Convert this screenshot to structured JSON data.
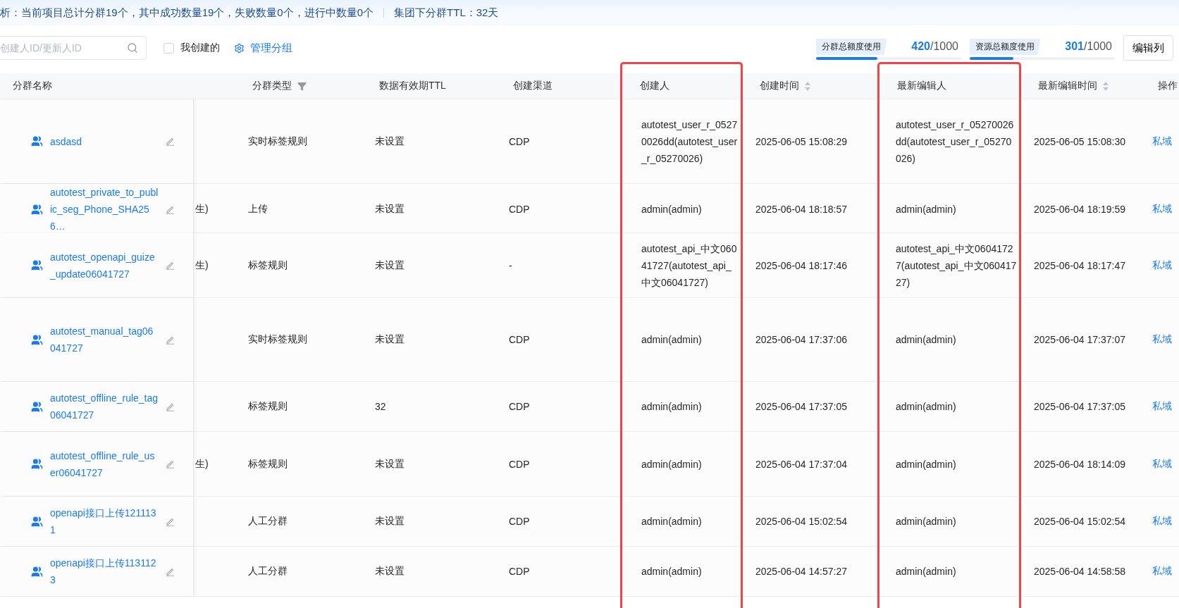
{
  "summary": {
    "text": "析：当前项目总计分群19个，其中成功数量19个，失败数量0个，进行中数量0个",
    "ttl": "集团下分群TTL：32天"
  },
  "toolbar": {
    "search": {
      "placeholder": "创建人ID/更新人ID"
    },
    "mine": {
      "label": "我创建的",
      "checked": false
    },
    "manage": "管理分组",
    "quotas": [
      {
        "label": "分群总额度使用",
        "used": "420",
        "total": "/1000",
        "level": 0.42
      },
      {
        "label": "资源总额度使用",
        "used": "301",
        "total": "/1000",
        "level": 0.3
      }
    ],
    "edit_columns": "编辑列"
  },
  "table": {
    "columns": [
      {
        "label": "分群名称"
      },
      {
        "label": "分群类型",
        "filter": true
      },
      {
        "label": "数据有效期TTL"
      },
      {
        "label": "创建渠道"
      },
      {
        "label": "创建人",
        "highlighted": true
      },
      {
        "label": "创建时间",
        "sortable": true
      },
      {
        "label": "最新编辑人",
        "highlighted": true
      },
      {
        "label": "最新编辑时间",
        "sortable": true
      },
      {
        "label": "操作"
      }
    ],
    "rows": [
      {
        "name": "asdasd",
        "column_2": "",
        "type": "实时标签规则",
        "ttl": "未设置",
        "channel": "CDP",
        "creator": "autotest_user_r_05270026dd(autotest_user_r_05270026)",
        "created": "2025-06-05 15:08:29",
        "editor": "autotest_user_r_05270026dd(autotest_user_r_05270026)",
        "edited": "2025-06-05 15:08:30",
        "action": "私域"
      },
      {
        "name": "autotest_private_to_public_seg_Phone_SHA256…",
        "column_2": "生)",
        "type": "上传",
        "ttl": "未设置",
        "channel": "CDP",
        "creator": "admin(admin)",
        "created": "2025-06-04 18:18:57",
        "editor": "admin(admin)",
        "edited": "2025-06-04 18:19:59",
        "action": "私域"
      },
      {
        "name": "autotest_openapi_guize_update06041727",
        "column_2": "生)",
        "type": "标签规则",
        "ttl": "未设置",
        "channel": "-",
        "creator": "autotest_api_中文06041727(autotest_api_中文06041727)",
        "created": "2025-06-04 18:17:46",
        "editor": "autotest_api_中文06041727(autotest_api_中文06041727)",
        "edited": "2025-06-04 18:17:47",
        "action": "私域"
      },
      {
        "name": "autotest_manual_tag06041727",
        "column_2": "",
        "type": "实时标签规则",
        "ttl": "未设置",
        "channel": "CDP",
        "creator": "admin(admin)",
        "created": "2025-06-04 17:37:06",
        "editor": "admin(admin)",
        "edited": "2025-06-04 17:37:07",
        "action": "私域"
      },
      {
        "name": "autotest_offline_rule_tag06041727",
        "column_2": "",
        "type": "标签规则",
        "ttl": "32",
        "channel": "CDP",
        "creator": "admin(admin)",
        "created": "2025-06-04 17:37:05",
        "editor": "admin(admin)",
        "edited": "2025-06-04 17:37:05",
        "action": "私域"
      },
      {
        "name": "autotest_offline_rule_user06041727",
        "column_2": "生)",
        "type": "标签规则",
        "ttl": "未设置",
        "channel": "CDP",
        "creator": "admin(admin)",
        "created": "2025-06-04 17:37:04",
        "editor": "admin(admin)",
        "edited": "2025-06-04 18:14:09",
        "action": "私域"
      },
      {
        "name": "openapi接口上传1211131",
        "column_2": "",
        "type": "人工分群",
        "ttl": "未设置",
        "channel": "CDP",
        "creator": "admin(admin)",
        "created": "2025-06-04 15:02:54",
        "editor": "admin(admin)",
        "edited": "2025-06-04 15:02:54",
        "action": "私域"
      },
      {
        "name": "openapi接口上传1131123",
        "column_2": "",
        "type": "人工分群",
        "ttl": "未设置",
        "channel": "CDP",
        "creator": "admin(admin)",
        "created": "2025-06-04 14:57:27",
        "editor": "admin(admin)",
        "edited": "2025-06-04 14:58:58",
        "action": "私域"
      }
    ]
  }
}
